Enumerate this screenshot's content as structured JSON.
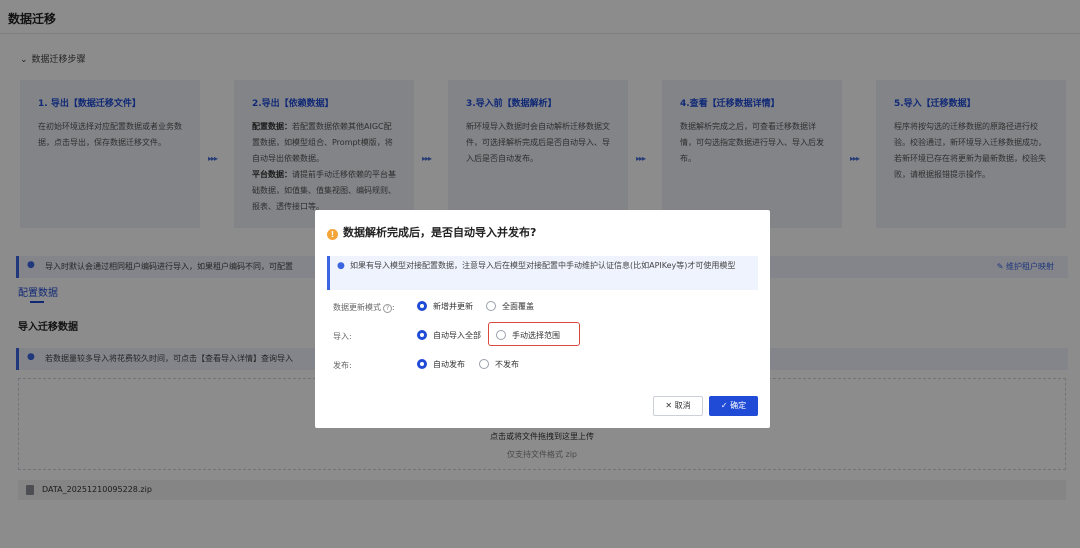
{
  "page": {
    "title": "数据迁移",
    "steps_toggle": "数据迁移步骤"
  },
  "steps": [
    {
      "title": "1. 导出【数据迁移文件】",
      "desc": "在初始环境选择对应配置数据或者业务数据，点击导出，保存数据迁移文件。"
    },
    {
      "title": "2.导出【依赖数据】",
      "desc_b1": "配置数据：",
      "desc_1": "若配置数据依赖其他AIGC配置数据，如模型组合、Prompt模版，将自动导出依赖数据。",
      "desc_b2": "平台数据：",
      "desc_2": "请提前手动迁移依赖的平台基础数据，如值集、值集视图、编码规则、报表、透传接口等。"
    },
    {
      "title": "3.导入前【数据解析】",
      "desc": "新环境导入数据时会自动解析迁移数据文件，可选择解析完成后是否自动导入、导入后是否自动发布。"
    },
    {
      "title": "4.查看【迁移数据详情】",
      "desc": "数据解析完成之后，可查看迁移数据详情，可勾选指定数据进行导入、导入后发布。"
    },
    {
      "title": "5.导入【迁移数据】",
      "desc": "程序将按勾选的迁移数据的原路径进行校验。校验通过，新环境导入迁移数据成功，若新环境已存在将更新为最新数据，校验失败，请根据报错提示操作。"
    }
  ],
  "info_bar": {
    "text": "导入时默认会通过相同租户编码进行导入，如果租户编码不同，可配置",
    "maintain_link": "维护租户映射"
  },
  "tabs": {
    "config": "配置数据"
  },
  "section": {
    "title": "导入迁移数据",
    "info": "若数据量较多导入将花费较久时间，可点击【查看导入详情】查询导入"
  },
  "upload": {
    "text": "点击或将文件拖拽到这里上传",
    "hint": "仅支持文件格式 zip"
  },
  "file": {
    "name": "DATA_20251210095228.zip"
  },
  "modal": {
    "title": "数据解析完成后，是否自动导入并发布?",
    "note": "如果有导入模型对接配置数据，注意导入后在模型对接配置中手动维护认证信息(比如APIKey等)才可使用模型",
    "update_mode": {
      "label": "数据更新模式",
      "options": [
        "新增并更新",
        "全面覆盖"
      ],
      "selected": "新增并更新"
    },
    "import": {
      "label": "导入:",
      "options": [
        "自动导入全部",
        "手动选择范围"
      ],
      "selected": "自动导入全部"
    },
    "publish": {
      "label": "发布:",
      "options": [
        "自动发布",
        "不发布"
      ],
      "selected": "自动发布"
    },
    "cancel_label": "取消",
    "ok_label": "确定"
  },
  "colors": {
    "primary": "#1f4bd6",
    "warning": "#f3a53a",
    "highlight": "#d94a3a"
  }
}
